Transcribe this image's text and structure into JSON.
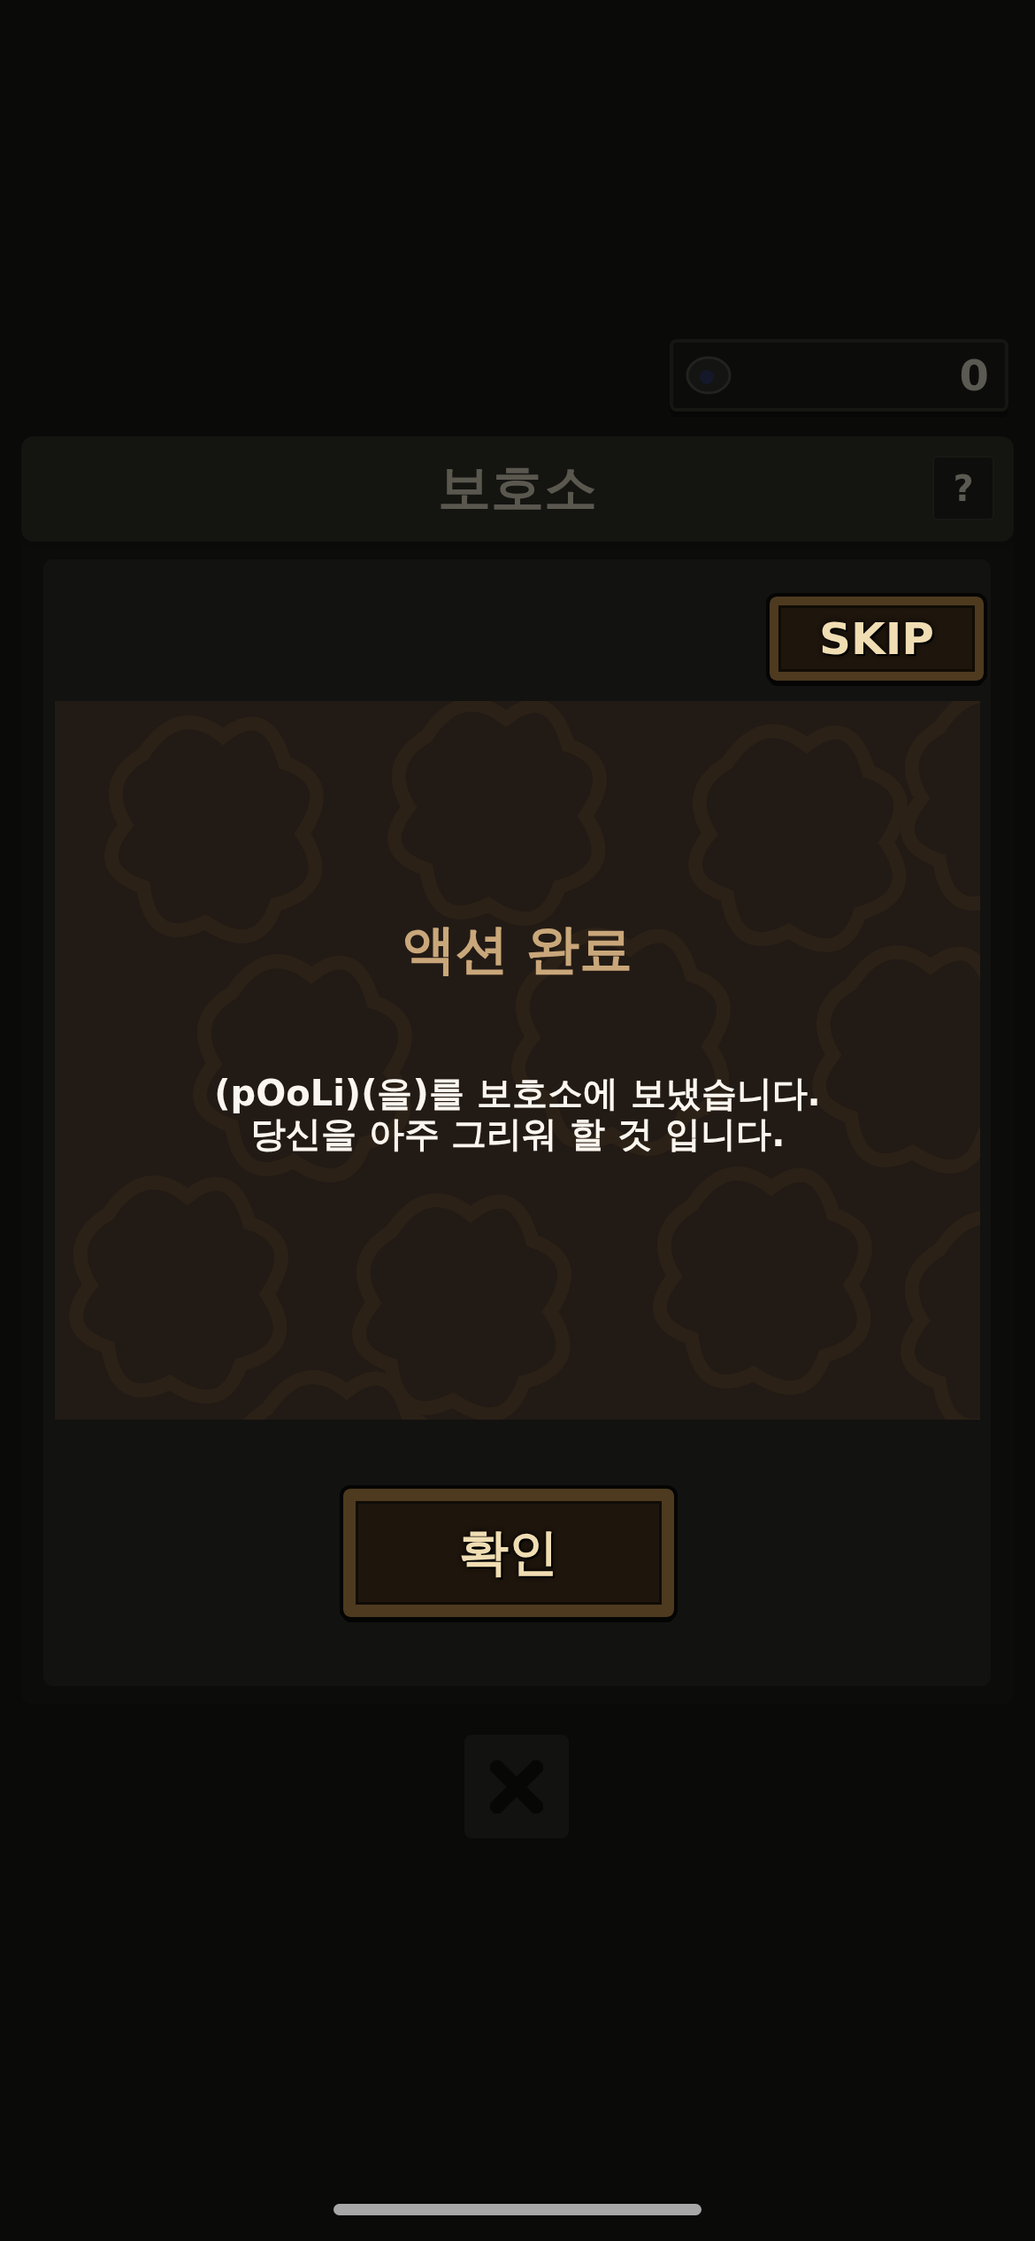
{
  "currency": {
    "value": "0"
  },
  "header": {
    "title": "보호소",
    "help_label": "?"
  },
  "skip_button": {
    "label": "SKIP"
  },
  "dialog": {
    "title": "액션 완료",
    "message": "(pOoLi)(을)를 보호소에 보냈습니다.\n당신을 아주 그리워 할 것 입니다.",
    "confirm_button": "확인"
  }
}
